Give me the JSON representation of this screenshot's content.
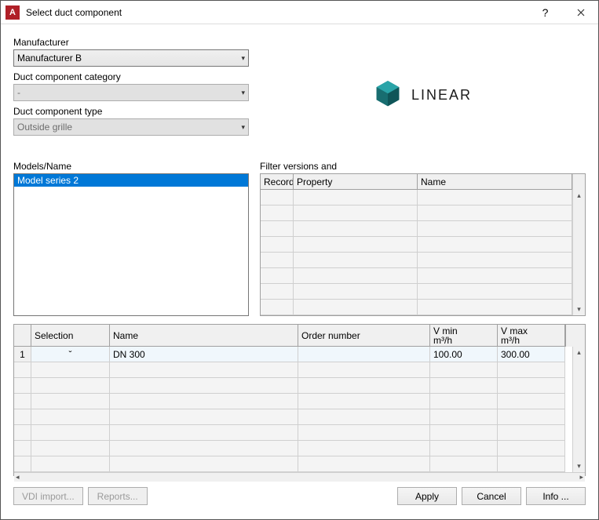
{
  "window": {
    "title": "Select duct component",
    "app_icon_letter": "A"
  },
  "left": {
    "manufacturer_label": "Manufacturer",
    "manufacturer_value": "Manufacturer B",
    "category_label": "Duct component category",
    "category_value": "-",
    "type_label": "Duct component type",
    "type_value": "Outside grille",
    "models_label": "Models/Name",
    "models_items": [
      "Model series 2"
    ]
  },
  "preview": {
    "brand": "LINEAR"
  },
  "filter": {
    "title": "Filter versions and",
    "headers": {
      "record": "Record",
      "property": "Property",
      "name": "Name"
    }
  },
  "spec_table": {
    "headers": {
      "selection": "Selection",
      "name": "Name",
      "order": "Order number",
      "vmin": "V min\nm³/h",
      "vmax": "V max\nm³/h"
    },
    "rows": [
      {
        "index": "1",
        "selection_symbol": "ˇ",
        "name": "DN 300",
        "order": "",
        "vmin": "100.00",
        "vmax": "300.00"
      }
    ]
  },
  "buttons": {
    "vdi": "VDI import...",
    "reports": "Reports...",
    "apply": "Apply",
    "cancel": "Cancel",
    "info": "Info ..."
  }
}
